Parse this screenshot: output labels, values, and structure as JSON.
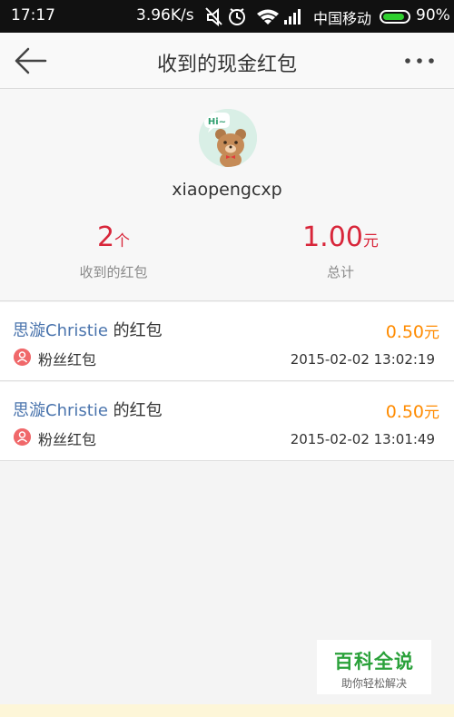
{
  "status_bar": {
    "time": "17:17",
    "speed": "3.96K/s",
    "carrier": "中国移动",
    "battery_level": 0.9,
    "battery_text": "90%",
    "icons": [
      "mute-icon",
      "alarm-icon",
      "wifi-icon",
      "signal-icon",
      "battery-icon"
    ]
  },
  "navbar": {
    "back_icon": "arrow-left-icon",
    "title": "收到的现金红包",
    "more_icon": "more-dots-icon"
  },
  "profile": {
    "username": "xiaopengcxp",
    "avatar_text": "Hi~",
    "received": {
      "count": "2",
      "unit": "个",
      "label": "收到的红包"
    },
    "total": {
      "amount": "1.00",
      "unit": "元",
      "label": "总计"
    }
  },
  "items": [
    {
      "sender": "思漩Christie",
      "suffix": " 的红包",
      "amount": "0.50",
      "unit": "元",
      "type_label": "粉丝红包",
      "time": "2015-02-02 13:02:19"
    },
    {
      "sender": "思漩Christie",
      "suffix": " 的红包",
      "amount": "0.50",
      "unit": "元",
      "type_label": "粉丝红包",
      "time": "2015-02-02 13:01:49"
    }
  ],
  "watermark": {
    "title": "百科全说",
    "subtitle": "助你轻松解决"
  },
  "colors": {
    "accent_red": "#d8263a",
    "amount_orange": "#ff8b00",
    "sender_blue": "#4a74ad",
    "watermark_green": "#2aa13a"
  }
}
